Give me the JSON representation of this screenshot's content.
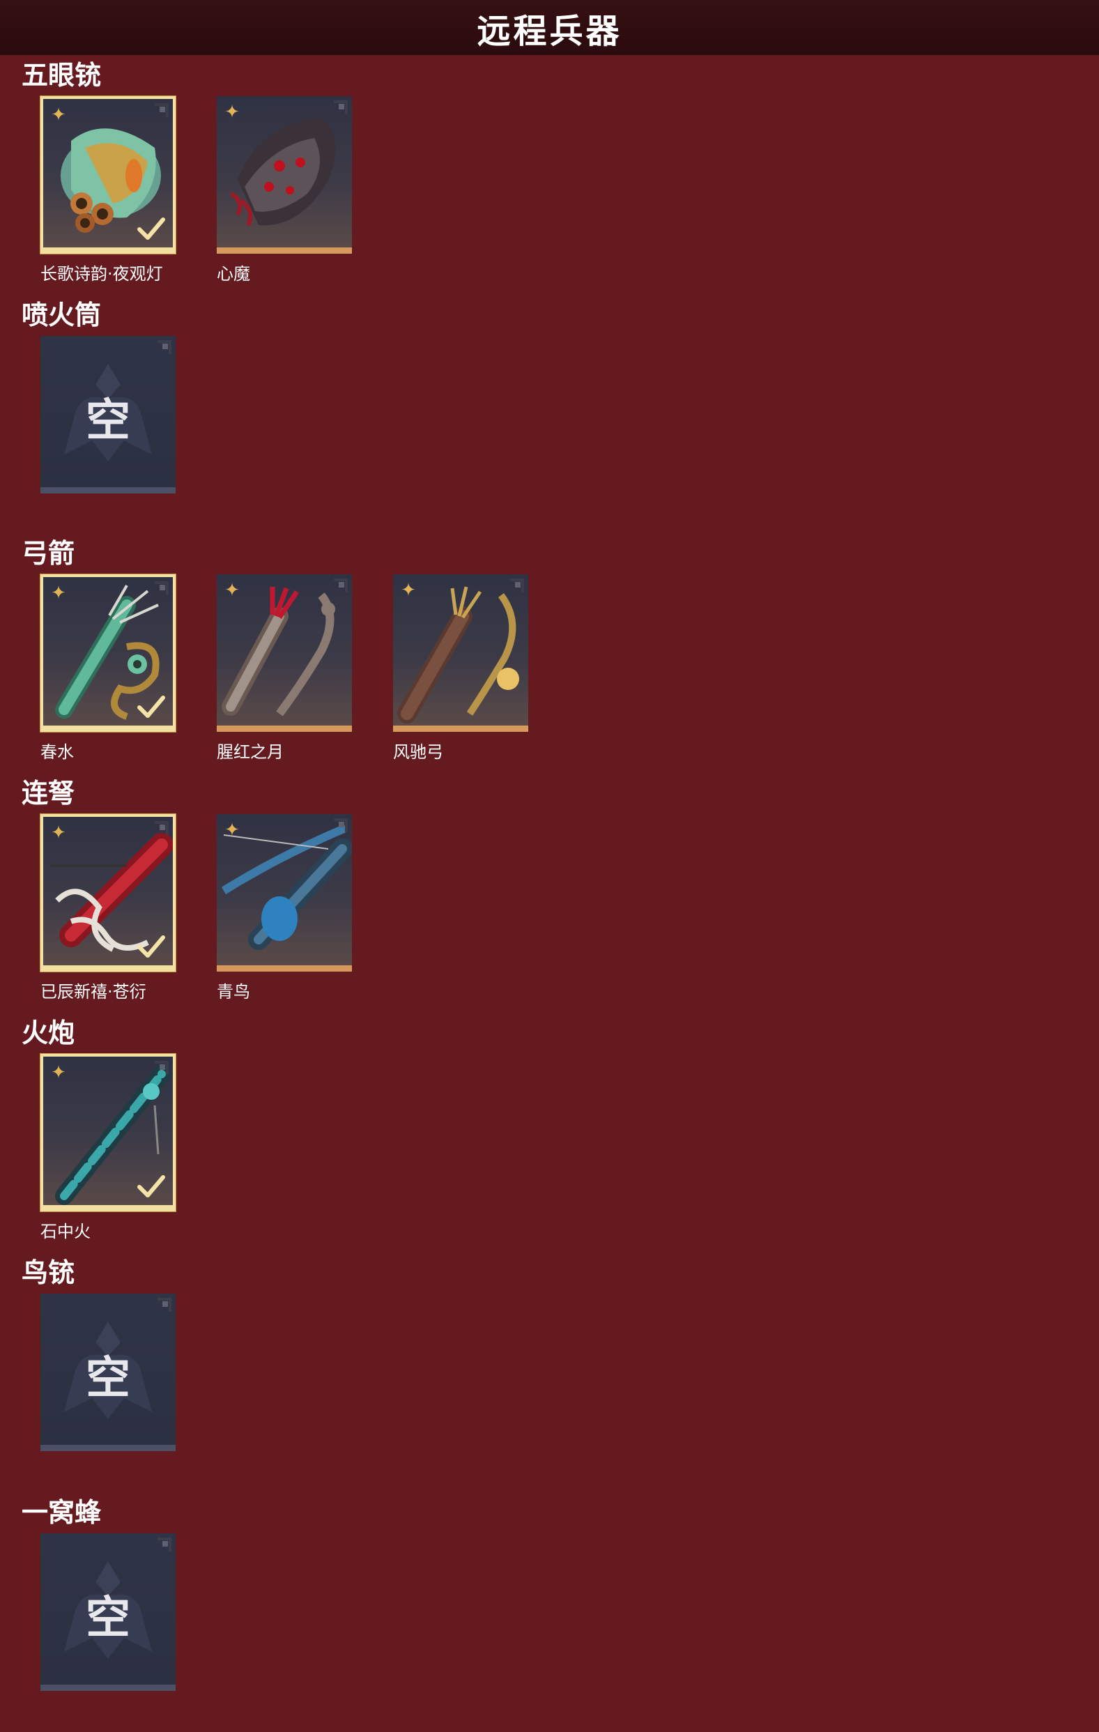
{
  "title": "远程兵器",
  "empty_text": "空",
  "sections": [
    {
      "title": "五眼铳",
      "items": [
        {
          "name": "长歌诗韵·夜观灯",
          "equipped": true,
          "icon": "five-barrel-gun-jade-icon"
        },
        {
          "name": "心魔",
          "equipped": false,
          "icon": "five-barrel-gun-demon-icon"
        }
      ]
    },
    {
      "title": "喷火筒",
      "items": []
    },
    {
      "title": "弓箭",
      "items": [
        {
          "name": "春水",
          "equipped": true,
          "icon": "bow-jade-icon"
        },
        {
          "name": "腥红之月",
          "equipped": false,
          "icon": "bow-crimson-icon"
        },
        {
          "name": "风驰弓",
          "equipped": false,
          "icon": "bow-gold-icon"
        }
      ]
    },
    {
      "title": "连弩",
      "items": [
        {
          "name": "已辰新禧·苍衍",
          "equipped": true,
          "icon": "crossbow-red-icon"
        },
        {
          "name": "青鸟",
          "equipped": false,
          "icon": "crossbow-blue-icon"
        }
      ]
    },
    {
      "title": "火炮",
      "items": [
        {
          "name": "石中火",
          "equipped": true,
          "icon": "cannon-cyan-icon"
        }
      ]
    },
    {
      "title": "鸟铳",
      "items": []
    },
    {
      "title": "一窝蜂",
      "items": []
    }
  ],
  "colors": {
    "background": "#651a1f",
    "topbar": "#2a0b0d",
    "equipped_border": "#f3dfa0",
    "card_bottom": "#d59a5c",
    "star": "#e2b457"
  }
}
